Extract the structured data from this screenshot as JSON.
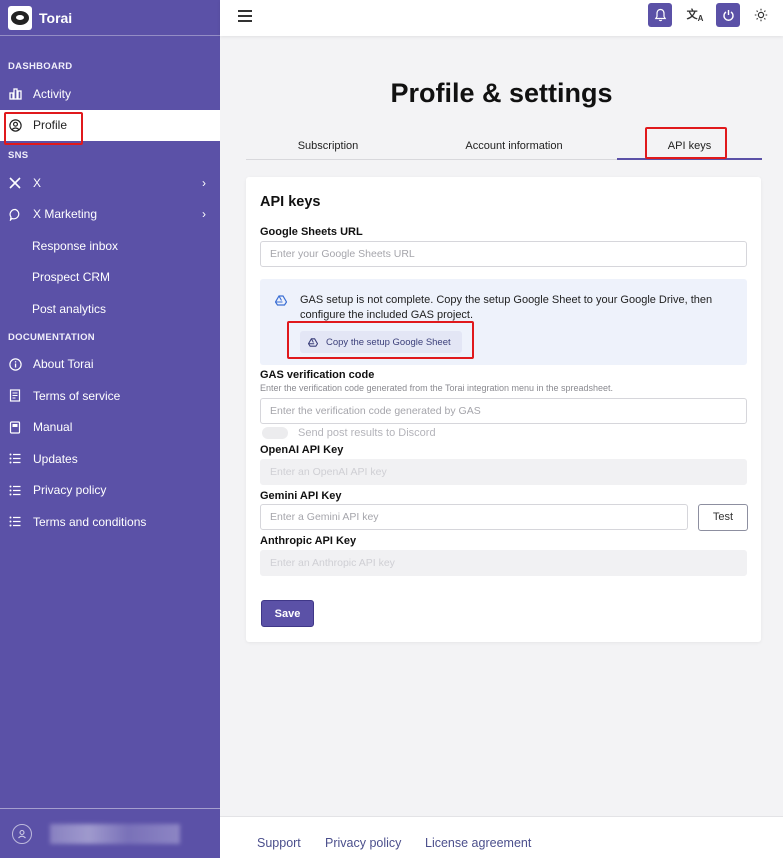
{
  "app": {
    "name": "Torai"
  },
  "sidebar": {
    "sections": {
      "dashboard": "DASHBOARD",
      "sns": "SNS",
      "documentation": "DOCUMENTATION"
    },
    "items": {
      "activity": "Activity",
      "profile": "Profile",
      "x": "X",
      "x_marketing": "X Marketing",
      "response_inbox": "Response inbox",
      "prospect_crm": "Prospect CRM",
      "post_analytics": "Post analytics",
      "about": "About Torai",
      "terms_of_service": "Terms of service",
      "manual": "Manual",
      "updates": "Updates",
      "privacy_policy": "Privacy policy",
      "terms_and_conditions": "Terms and conditions"
    },
    "active_item": "profile"
  },
  "topbar": {
    "icons": [
      "menu-icon",
      "bell-icon",
      "translate-icon",
      "power-icon",
      "sun-icon"
    ]
  },
  "main": {
    "title": "Profile & settings",
    "tabs": [
      {
        "label": "Subscription",
        "active": false
      },
      {
        "label": "Account information",
        "active": false
      },
      {
        "label": "API keys",
        "active": true
      }
    ]
  },
  "card": {
    "title": "API keys",
    "sheets": {
      "label": "Google Sheets URL",
      "placeholder": "Enter your Google Sheets URL"
    },
    "alert": {
      "text": "GAS setup is not complete. Copy the setup Google Sheet to your Google Drive, then configure the included GAS project.",
      "button": "Copy the setup Google Sheet"
    },
    "gas": {
      "label": "GAS verification code",
      "hint": "Enter the verification code generated from the Torai integration menu in the spreadsheet.",
      "placeholder": "Enter the verification code generated by GAS"
    },
    "discord": {
      "label": "Send post results to Discord",
      "enabled": false
    },
    "openai": {
      "label": "OpenAI API Key",
      "placeholder": "Enter an OpenAI API key"
    },
    "gemini": {
      "label": "Gemini API Key",
      "placeholder": "Enter a Gemini API key",
      "test_button": "Test"
    },
    "anthropic": {
      "label": "Anthropic API Key",
      "placeholder": "Enter an Anthropic API key"
    },
    "save_button": "Save"
  },
  "footer": {
    "links": [
      "Support",
      "Privacy policy",
      "License agreement"
    ]
  },
  "colors": {
    "brand": "#5b51a7",
    "highlight": "#e0191c",
    "alert_bg": "#eef2fb"
  }
}
